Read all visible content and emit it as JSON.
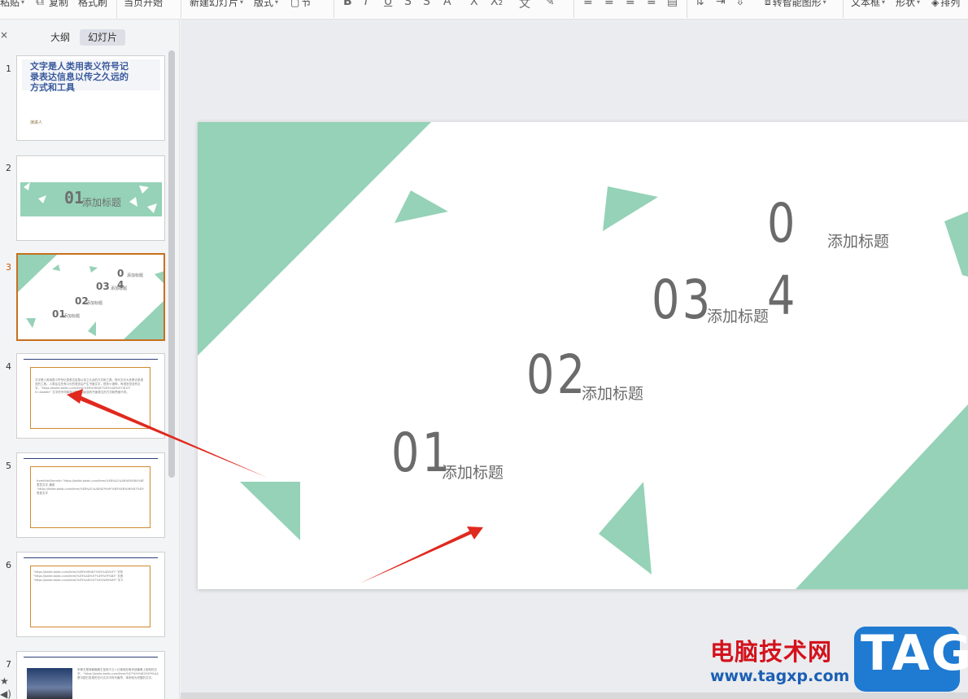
{
  "toolbar": {
    "paste": "粘贴",
    "copy": "复制",
    "format_painter": "格式刷",
    "start_from_current": "当页开始",
    "new_slide": "新建幻灯片",
    "layout": "版式",
    "section": "节",
    "convert_smartart": "转智能图形",
    "textbox": "文本框",
    "shape": "形状",
    "arrange": "排列"
  },
  "pane": {
    "tabs": {
      "outline": "大纲",
      "slides": "幻灯片"
    },
    "close_glyph": "×"
  },
  "thumbnails": [
    {
      "number": "1",
      "title": "文字是人类用表义符号记录表达信息以传之久远的方式和工具",
      "author": "演讲人"
    },
    {
      "number": "2",
      "num_text": "01",
      "label": "添加标题"
    },
    {
      "number": "3",
      "active": true,
      "items": [
        {
          "num": "0",
          "label": "添加标题"
        },
        {
          "num": "03",
          "label": "添加标题"
        },
        {
          "num": "4",
          "label": ""
        },
        {
          "num": "02",
          "label": "添加标题"
        },
        {
          "num": "01",
          "label": "添加标题"
        }
      ]
    },
    {
      "number": "4",
      "body": "文字是人类用表义符号记录表达信息以传之久远的方式和工具。现代文字大多是记录语言的工具。人类往往先有口头的语言后产生书面文字，很多小语种，有语言但没有文字。\"https://baike.baidu.com/item/%E6%96%87%E5%AD%97/612?fr=aladdin\" 文字的不同体现了国家和民族的书面表达的方式和思维不同。"
    },
    {
      "number": "5",
      "body": "fromtitle&fromid=\"https://baike.baidu.com/item/%E8%A1%A8%E6%84%8F%E6%96%87%E5%AD%97\" 表意文字 通常 \"https://baike.baidu.com/item/%E8%A1%A8%E9%9F%B3%E6%96%87%E5%AD%97\" 表音文字"
    },
    {
      "number": "6",
      "body": "\"https://baike.baidu.com/item/%E6%96%87%E5%AD%97\" 字形 \"https://baike.baidu.com/item/%E5%AD%97%E9%9F%B3\" 字音 \"https://baike.baidu.com/item/%E5%AD%97%E4%B9%89\" 字义"
    },
    {
      "number": "7",
      "body": "甲骨文是商朝晚期王室用于占卜记事而在龟甲或兽骨上契刻的文字，\"https://baike.baidu.com/item/%E7%94%B2%E9%AA%A8%E6%96%87\" 是中国已发现的古代文字中时代最早、体系较为完整的文字。"
    }
  ],
  "slide": {
    "items": [
      {
        "num": "0",
        "label": "添加标题"
      },
      {
        "num": "03",
        "label": "添加标题"
      },
      {
        "num": "4",
        "label": ""
      },
      {
        "num": "02",
        "label": "添加标题"
      },
      {
        "num": "01",
        "label": "添加标题"
      }
    ],
    "accent_color": "#95d2b7",
    "text_color": "#6b6b6b"
  },
  "annotations": {
    "arrow_color": "#e0291f"
  },
  "watermark": {
    "site_name": "电脑技术网",
    "url": "www.tagxp.com",
    "badge": "TAG"
  }
}
